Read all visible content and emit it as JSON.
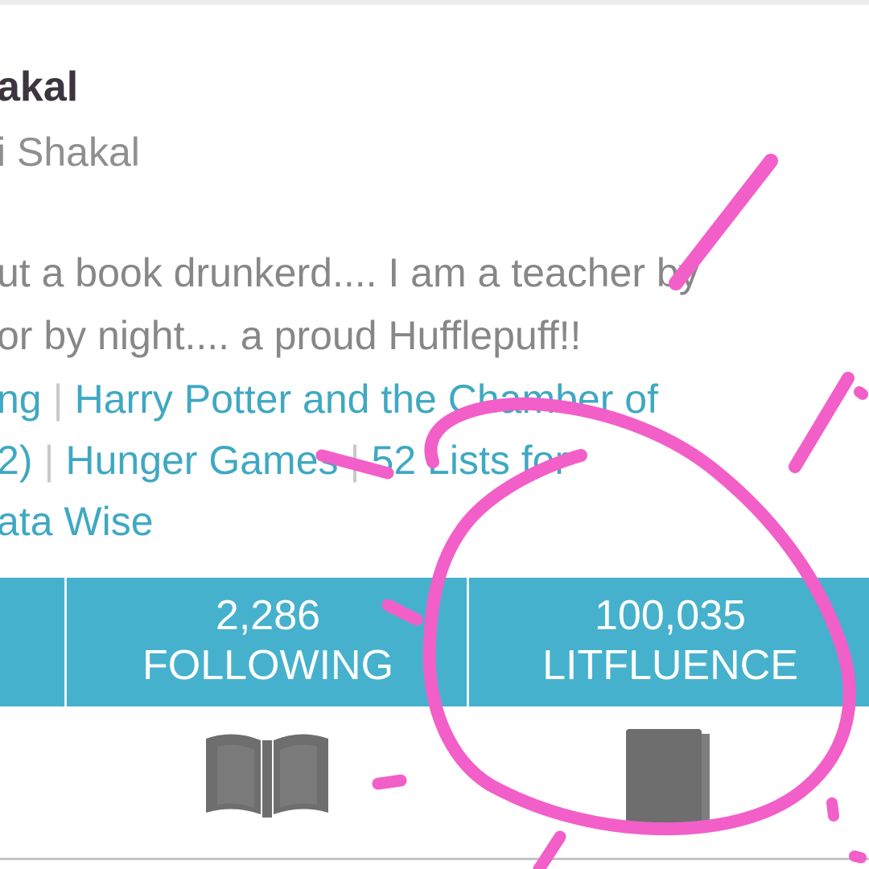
{
  "profile": {
    "name": "akal",
    "handle": "i Shakal",
    "bio_lines": [
      "ut a book drunkerd....  I am a teacher by",
      "or by night.... a proud Hufflepuff!!"
    ]
  },
  "favorites": {
    "row1": [
      "ng",
      "Harry Potter and the Chamber of"
    ],
    "row2": [
      "2)",
      "Hunger Games",
      "52 Lists for"
    ],
    "row3": [
      "ata Wise"
    ]
  },
  "stats": {
    "following": {
      "value": "2,286",
      "label": "FOLLOWING"
    },
    "litfluence": {
      "value": "100,035",
      "label": "LITFLUENCE"
    }
  },
  "icons": {
    "left": "open-book-icon",
    "right": "closed-book-icon"
  },
  "colors": {
    "stats_bar": "#46b1cd",
    "link": "#3fa8c2",
    "annotation": "#f25fc8"
  }
}
